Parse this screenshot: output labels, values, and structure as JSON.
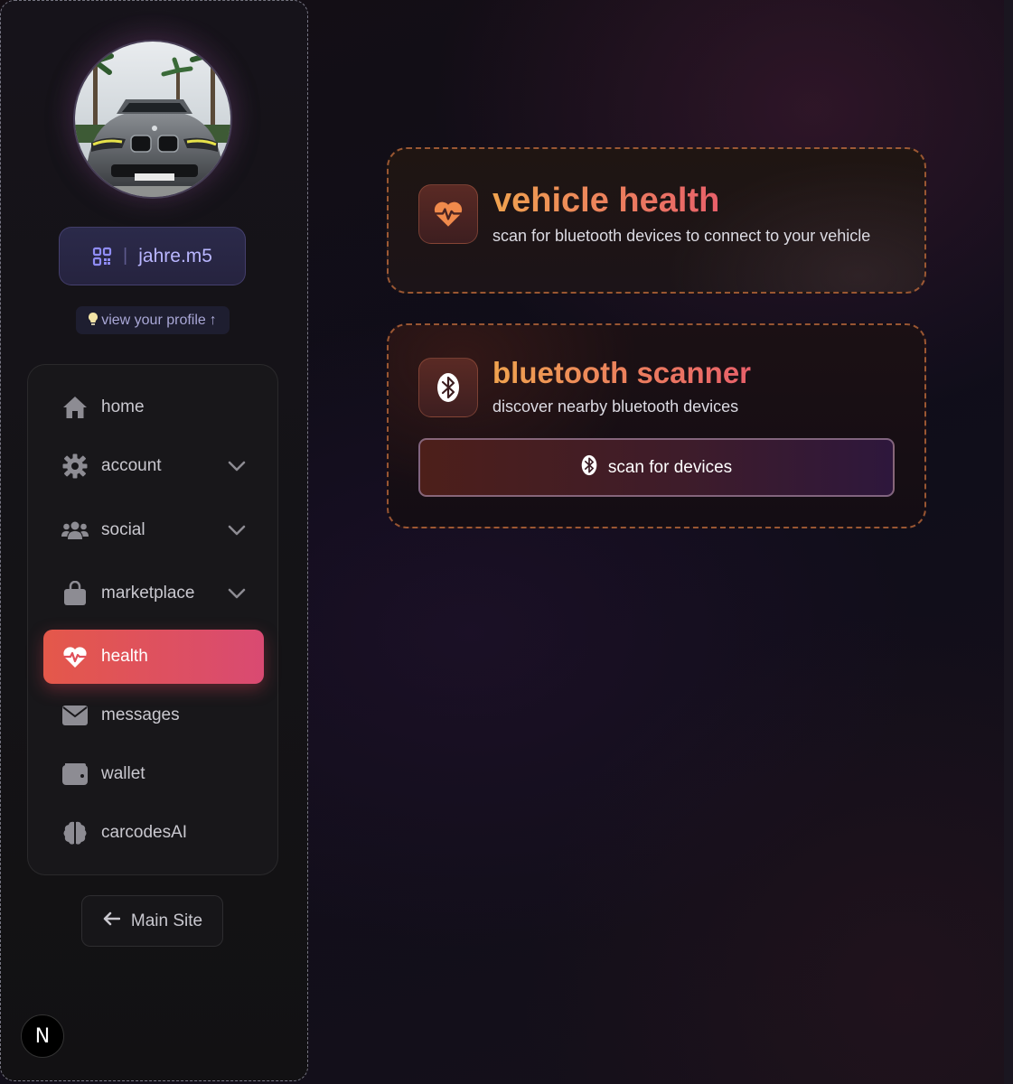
{
  "sidebar": {
    "avatar_alt": "profile photo of a gray car",
    "username": "jahre.m5",
    "username_separator": "|",
    "profile_hint": "view your profile",
    "profile_hint_arrow": "↑",
    "nav": [
      {
        "label": "home",
        "icon": "home-icon",
        "expandable": false
      },
      {
        "label": "account",
        "icon": "gear-icon",
        "expandable": true
      },
      {
        "label": "social",
        "icon": "users-icon",
        "expandable": true
      },
      {
        "label": "marketplace",
        "icon": "shopping-bag-icon",
        "expandable": true
      },
      {
        "label": "health",
        "icon": "heart-pulse-icon",
        "expandable": false,
        "active": true
      },
      {
        "label": "messages",
        "icon": "envelope-icon",
        "expandable": false
      },
      {
        "label": "wallet",
        "icon": "wallet-icon",
        "expandable": false
      },
      {
        "label": "carcodesAI",
        "icon": "brain-icon",
        "expandable": false
      }
    ],
    "main_site": "Main Site",
    "badge_letter": "N"
  },
  "cards": {
    "vehicle_health": {
      "title": "vehicle health",
      "subtitle": "scan for bluetooth devices to connect to your vehicle",
      "icon": "heart-pulse-icon"
    },
    "bluetooth_scanner": {
      "title": "bluetooth scanner",
      "subtitle": "discover nearby bluetooth devices",
      "icon": "bluetooth-icon",
      "button_label": "scan for devices"
    }
  },
  "colors": {
    "accent_orange": "#f0a34f",
    "accent_pink": "#e8606a",
    "active_nav_start": "#e4584a",
    "active_nav_end": "#d94a72",
    "username_text": "#b9b6ff"
  }
}
